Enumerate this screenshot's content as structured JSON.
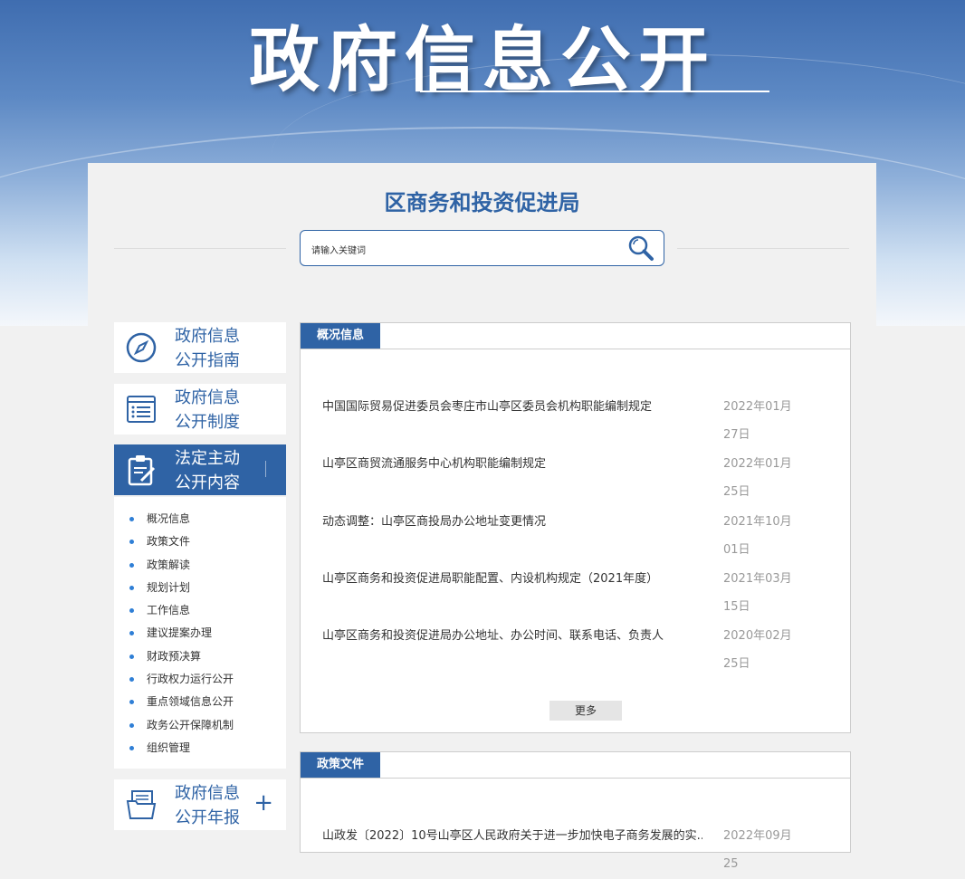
{
  "banner": {
    "title": "政府信息公开"
  },
  "org_title": "区商务和投资促进局",
  "search": {
    "placeholder": "请输入关键词",
    "value": "请输入关键词"
  },
  "sidebar": {
    "cards": [
      {
        "label_1": "政府信息",
        "label_2": "公开指南",
        "icon": "compass-icon"
      },
      {
        "label_1": "政府信息",
        "label_2": "公开制度",
        "icon": "list-document-icon"
      },
      {
        "label_1": "法定主动",
        "label_2": "公开内容",
        "icon": "clipboard-edit-icon"
      },
      {
        "label_1": "政府信息",
        "label_2": "公开年报",
        "icon": "folder-icon",
        "expand": "+"
      }
    ],
    "sub_items": [
      "概况信息",
      "政策文件",
      "政策解读",
      "规划计划",
      "工作信息",
      "建议提案办理",
      "财政预决算",
      "行政权力运行公开",
      "重点领域信息公开",
      "政务公开保障机制",
      "组织管理"
    ]
  },
  "sections": [
    {
      "tab": "概况信息",
      "items": [
        {
          "title": "中国国际贸易促进委员会枣庄市山亭区委员会机构职能编制规定",
          "date": "2022年01月27日"
        },
        {
          "title": "山亭区商贸流通服务中心机构职能编制规定",
          "date": "2022年01月25日"
        },
        {
          "title": "动态调整：山亭区商投局办公地址变更情况",
          "date": "2021年10月01日"
        },
        {
          "title": "山亭区商务和投资促进局职能配置、内设机构规定（2021年度）",
          "date": "2021年03月15日"
        },
        {
          "title": "山亭区商务和投资促进局办公地址、办公时间、联系电话、负责人",
          "date": "2020年02月25日"
        }
      ],
      "more": "更多"
    },
    {
      "tab": "政策文件",
      "items": [
        {
          "title": "山政发〔2022〕10号山亭区人民政府关于进一步加快电子商务发展的实...",
          "date": "2022年09月25"
        }
      ]
    }
  ],
  "colors": {
    "primary": "#2f63a5",
    "accent": "#2f7fd6"
  }
}
